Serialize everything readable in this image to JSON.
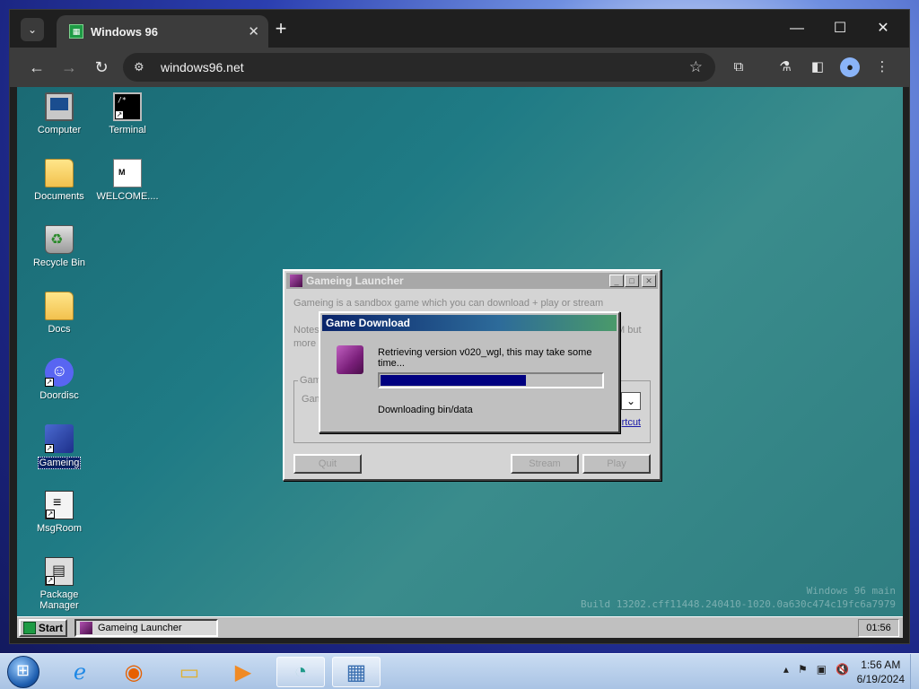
{
  "browser": {
    "tab_title": "Windows 96",
    "url": "windows96.net",
    "new_tab": "+",
    "close": "✕"
  },
  "desktop_icons": [
    {
      "label": "Computer"
    },
    {
      "label": "Terminal"
    },
    {
      "label": "Documents"
    },
    {
      "label": "WELCOME...."
    },
    {
      "label": "Recycle Bin"
    },
    {
      "label": "Docs"
    },
    {
      "label": "Doordisc"
    },
    {
      "label": "Gameing"
    },
    {
      "label": "MsgRoom"
    },
    {
      "label": "Package Manager"
    }
  ],
  "watermark": {
    "line1": "Windows 96 main",
    "line2": "Build 13202.cff11448.240410-1020.0a630c474c19fc6a7979"
  },
  "launcher": {
    "title": "Gameing Launcher",
    "description": "Gameing is a sandbox game which you can download + play or stream",
    "notes_line1": "Notes",
    "notes_line1_right": "M but",
    "notes_line2": "more",
    "group_label": "Gam",
    "game_label": "Gam",
    "shortcut_link": "rtcut",
    "quit_label": "Quit",
    "stream_label": "Stream",
    "play_label": "Play"
  },
  "download_dialog": {
    "title": "Game Download",
    "message": "Retrieving version v020_wgl, this may take some time...",
    "progress": 0.66,
    "status": "Downloading bin/data"
  },
  "w96_taskbar": {
    "start_label": "Start",
    "task_label": "Gameing Launcher",
    "clock": "01:56"
  },
  "win7_taskbar": {
    "time": "1:56 AM",
    "date": "6/19/2024"
  }
}
